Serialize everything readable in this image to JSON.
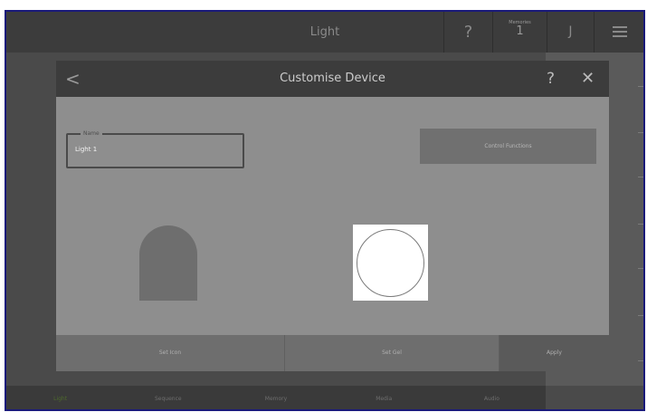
{
  "header": {
    "title": "Light",
    "help": "?",
    "memories_label": "Memories",
    "memories_value": "1",
    "j_label": "J",
    "menu_icon": "hamburger-icon"
  },
  "dialog": {
    "back": "<",
    "title": "Customise Device",
    "help": "?",
    "close": "✕",
    "name_legend": "Name",
    "name_value": "Light 1",
    "control_functions": "Control Functions",
    "set_icon": "Set Icon",
    "set_gel": "Set Gel",
    "apply": "Apply"
  },
  "bottom_nav": {
    "items": [
      {
        "label": "Light"
      },
      {
        "label": "Sequence"
      },
      {
        "label": "Memory"
      },
      {
        "label": "Media"
      },
      {
        "label": "Audio"
      }
    ],
    "active_color": "#4f6b2c"
  },
  "colors": {
    "frame_border": "#1a1a7a",
    "dialog_bg": "#8e8e8e",
    "header_bg": "#3c3c3c"
  }
}
